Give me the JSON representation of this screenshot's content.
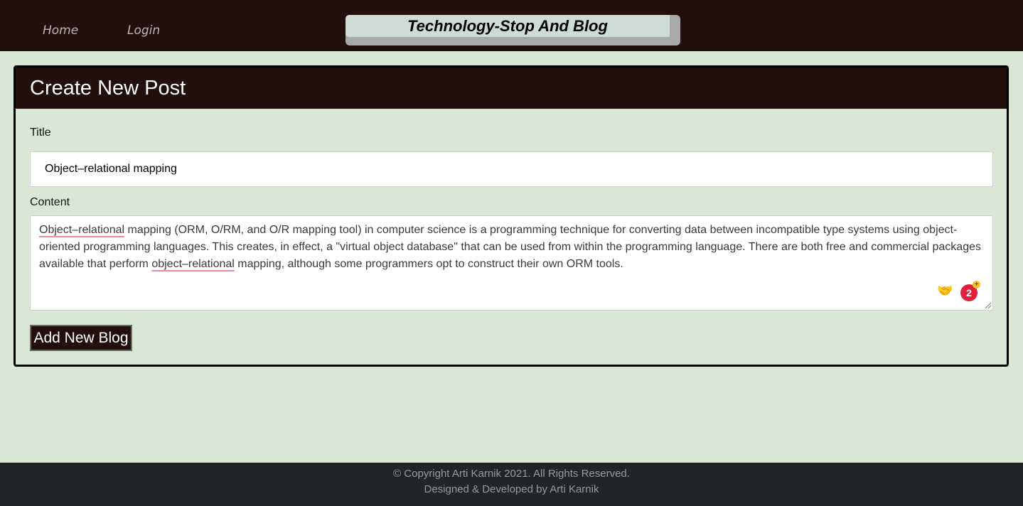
{
  "nav": {
    "home_label": "Home",
    "login_label": "Login",
    "brand": "Technology-Stop And Blog"
  },
  "form": {
    "heading": "Create New Post",
    "title_label": "Title",
    "title_value": "Object–relational mapping",
    "content_label": "Content",
    "content_parts": {
      "p1_spell": "Object–relational",
      "p2": " mapping (ORM, O/RM, and O/R mapping tool) in computer science is a programming technique for converting data between incompatible type systems using object-oriented programming languages. This creates, in effect, a \"virtual object database\" that can be used from within the programming language. There are both free and commercial packages available that perform ",
      "p3_spell": "object–relational",
      "p4": " mapping, although some programmers opt to construct their own ORM tools."
    },
    "submit_label": "Add New Blog"
  },
  "extensions": {
    "badge_count": "2",
    "plus": "+",
    "hand_icon": "handshake-icon"
  },
  "footer": {
    "copyright": "© Copyright Arti Karnik 2021. All Rights Reserved.",
    "credit": "Designed & Developed by Arti Karnik"
  },
  "colors": {
    "nav_bg": "#230e0e",
    "page_bg": "#d9e8d4",
    "footer_bg": "#212529",
    "badge_red": "#e0203a"
  }
}
